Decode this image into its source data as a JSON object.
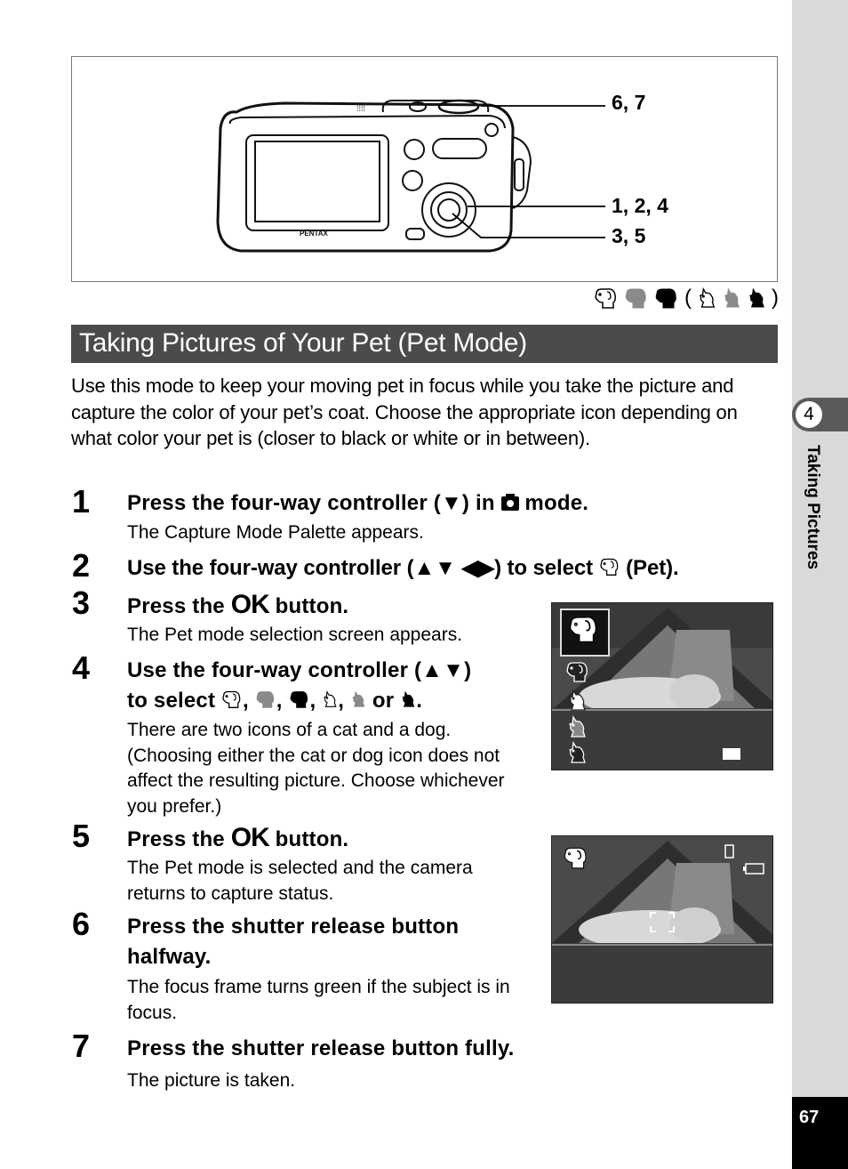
{
  "figure": {
    "brand": "PENTAX",
    "callouts": [
      "6, 7",
      "1, 2, 4",
      "3, 5"
    ]
  },
  "icon_legend": {
    "open_paren": "(",
    "close_paren": ")",
    "icons": [
      "dog-white-icon",
      "dog-gray-icon",
      "dog-black-icon",
      "cat-white-icon",
      "cat-gray-icon",
      "cat-black-icon"
    ]
  },
  "heading": "Taking Pictures of Your Pet (Pet Mode)",
  "intro": "Use this mode to keep your moving pet in focus while you take the picture and capture the color of your pet’s coat. Choose the appropriate icon depending on what color your pet is (closer to black or white or in between).",
  "steps": [
    {
      "num": "1",
      "title_a": "Press the four-way controller (▼) in ",
      "title_b": " mode.",
      "desc": "The Capture Mode Palette appears."
    },
    {
      "num": "2",
      "title_a": "Use the four-way controller (▲▼ ◀▶) to select ",
      "title_b": " (Pet)."
    },
    {
      "num": "3",
      "title_a": "Press the ",
      "ok": "OK",
      "title_b": " button.",
      "desc": "The Pet mode selection screen appears."
    },
    {
      "num": "4",
      "title_line1": "Use the four-way controller (▲▼)",
      "title_line2_a": "to select ",
      "sep": ",",
      "or": "or",
      "end": ".",
      "desc": "There are two icons of a cat and a dog. (Choosing either the cat or dog icon does not affect the resulting picture. Choose whichever you prefer.)"
    },
    {
      "num": "5",
      "title_a": "Press the ",
      "ok": "OK",
      "title_b": " button.",
      "desc": "The Pet mode is selected and the camera returns to capture status."
    },
    {
      "num": "6",
      "title": "Press the shutter release button halfway.",
      "desc": "The focus frame turns green if the subject is in focus."
    },
    {
      "num": "7",
      "title": "Press the shutter release button fully.",
      "desc": "The picture is taken."
    }
  ],
  "sidebar": {
    "chapter_number": "4",
    "chapter_title": "Taking Pictures",
    "page_number": "67"
  }
}
